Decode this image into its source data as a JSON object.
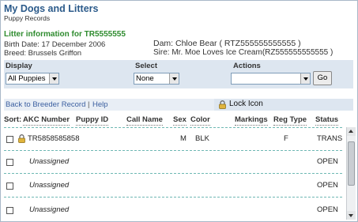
{
  "header": {
    "title": "My Dogs and Litters",
    "subtitle": "Puppy Records"
  },
  "litter": {
    "heading": "Litter information for TR5555555",
    "birth_date": "Birth Date: 17 December 2006",
    "breed": "Breed: Brussels Griffon",
    "dam": "Dam: Chloe Bear ( RTZ555555555555 )",
    "sire": "Sire: Mr. Moe Loves Ice Cream(RZ555555555555 )"
  },
  "controls": {
    "display_label": "Display",
    "display_value": "All Puppies",
    "select_label": "Select",
    "select_value": "None",
    "actions_label": "Actions",
    "actions_value": "",
    "go_label": "Go"
  },
  "links": {
    "back": "Back to Breeder Record",
    "separator": "|",
    "help": "Help",
    "lock": "Lock Icon"
  },
  "table": {
    "columns": {
      "sort": "Sort:",
      "akc": "AKC Number",
      "puppy_id": "Puppy ID",
      "call_name": "Call Name",
      "sex": "Sex",
      "color": "Color",
      "markings": "Markings",
      "reg_type": "Reg Type",
      "status": "Status"
    },
    "rows": [
      {
        "akc": "TR5858585858",
        "sex": "M",
        "color": "BLK",
        "reg_type": "F",
        "status": "TRANS",
        "locked": true
      },
      {
        "akc": "Unassigned",
        "sex": "",
        "color": "",
        "reg_type": "",
        "status": "OPEN",
        "locked": false
      },
      {
        "akc": "Unassigned",
        "sex": "",
        "color": "",
        "reg_type": "",
        "status": "OPEN",
        "locked": false
      },
      {
        "akc": "Unassigned",
        "sex": "",
        "color": "",
        "reg_type": "",
        "status": "OPEN",
        "locked": false
      }
    ]
  },
  "colors": {
    "title": "#2b5a8a",
    "heading": "#2e8b2e",
    "link": "#3b5fa0",
    "panel": "#dde6f0",
    "row_divider": "#6fb8b3"
  },
  "icons": {
    "lock": "lock-icon",
    "go": "go-button"
  }
}
